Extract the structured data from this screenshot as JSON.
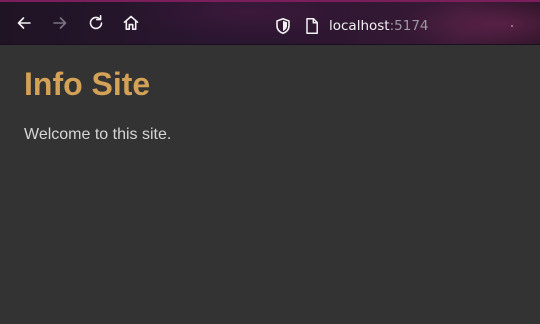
{
  "browser": {
    "toolbar": {
      "back_icon": "arrow-left-icon",
      "forward_icon": "arrow-right-icon",
      "reload_icon": "reload-icon",
      "home_icon": "home-icon",
      "forward_enabled": false
    },
    "urlbar": {
      "host": "localhost",
      "port": ":5174",
      "security_icon": "shield-icon",
      "page_icon": "page-icon"
    },
    "colors": {
      "toolbar_accent": "#7a1f5c",
      "icon": "#f2f2f2",
      "icon_disabled": "#7a7480"
    }
  },
  "page": {
    "heading": "Info Site",
    "body_text": "Welcome to this site.",
    "colors": {
      "background": "#333333",
      "heading": "#d4a257",
      "text": "#d6d6d6"
    }
  }
}
